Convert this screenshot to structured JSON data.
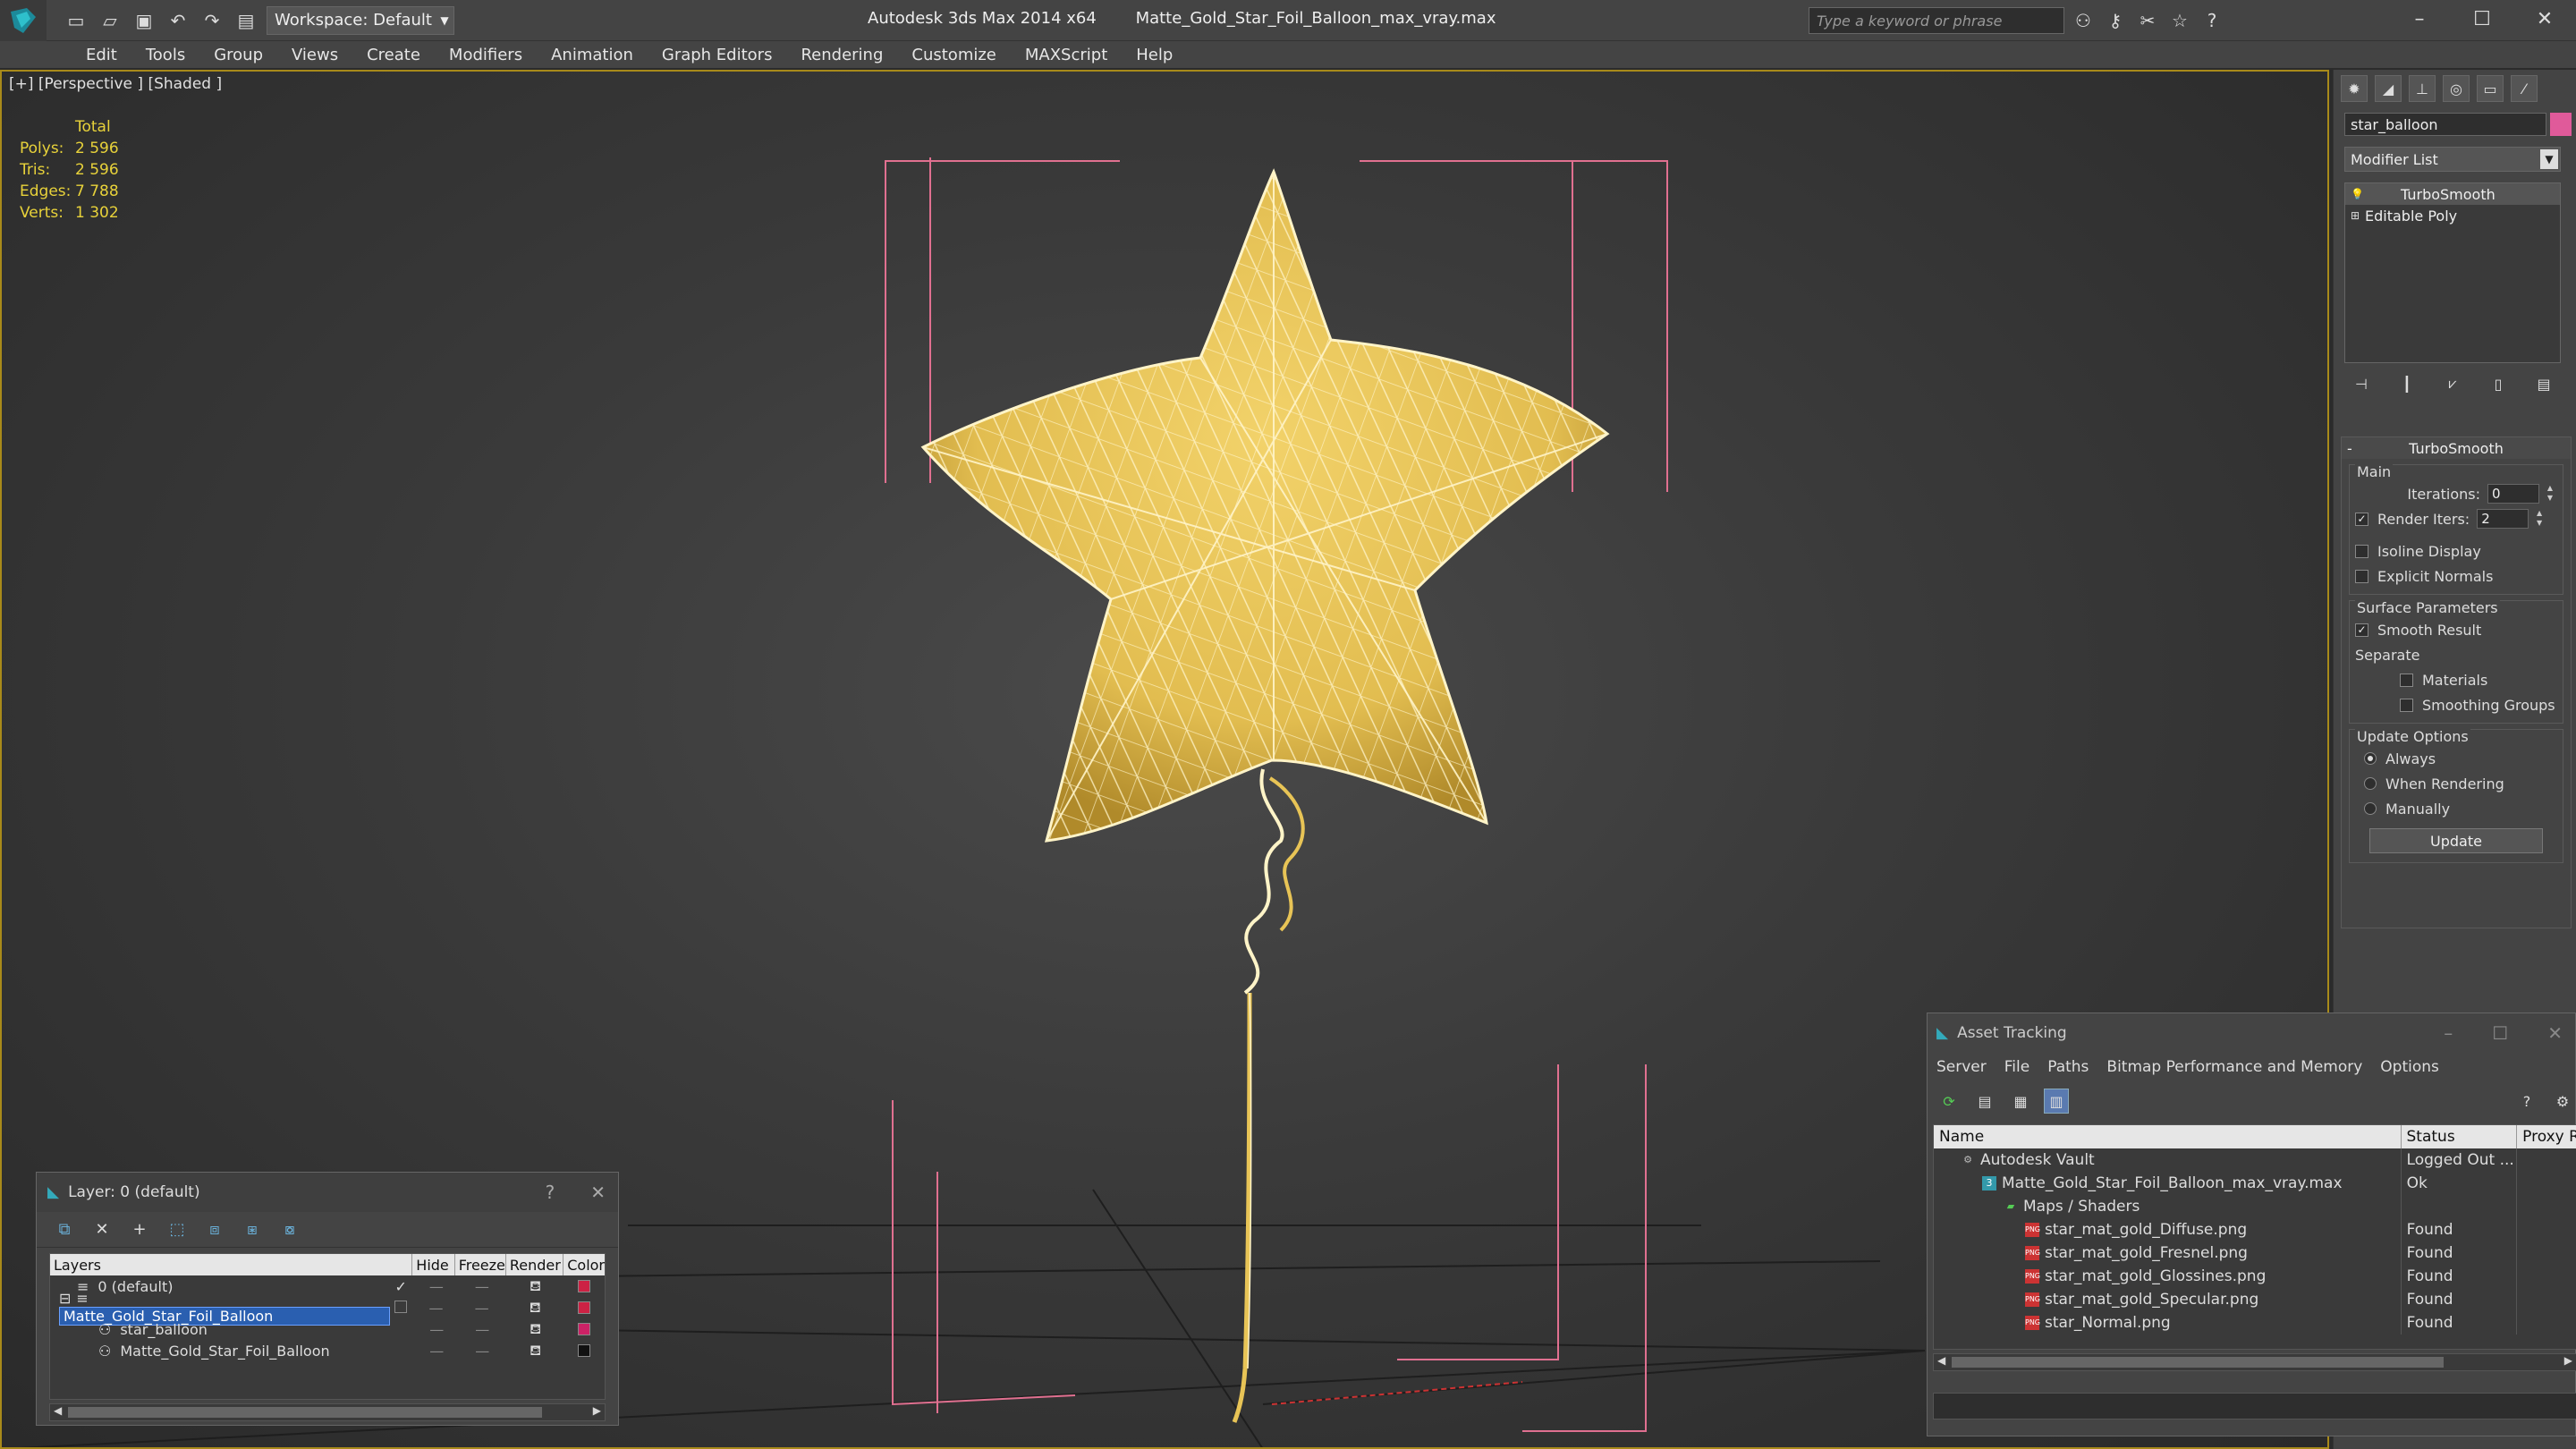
{
  "titlebar": {
    "workspace": "Workspace: Default",
    "app_title": "Autodesk 3ds Max  2014 x64",
    "file_title": "Matte_Gold_Star_Foil_Balloon_max_vray.max",
    "search_placeholder": "Type a keyword or phrase"
  },
  "menu": [
    "Edit",
    "Tools",
    "Group",
    "Views",
    "Create",
    "Modifiers",
    "Animation",
    "Graph Editors",
    "Rendering",
    "Customize",
    "MAXScript",
    "Help"
  ],
  "viewport": {
    "label": "[+] [Perspective ] [Shaded ]",
    "stats": {
      "header": "Total",
      "rows": [
        {
          "k": "Polys:",
          "v": "2 596"
        },
        {
          "k": "Tris:",
          "v": "2 596"
        },
        {
          "k": "Edges:",
          "v": "7 788"
        },
        {
          "k": "Verts:",
          "v": "1 302"
        }
      ]
    }
  },
  "command_panel": {
    "object_name": "star_balloon",
    "object_color": "#e05a9a",
    "modifier_list": "Modifier List",
    "stack": [
      "TurboSmooth",
      "Editable Poly"
    ],
    "rollout_title": "TurboSmooth",
    "main_group": "Main",
    "iterations_label": "Iterations:",
    "iterations_value": "0",
    "render_iters_label": "Render Iters:",
    "render_iters_value": "2",
    "isoline": "Isoline Display",
    "explicit_normals": "Explicit Normals",
    "surface_group": "Surface Parameters",
    "smooth_result": "Smooth Result",
    "separate": "Separate",
    "materials": "Materials",
    "smoothing_groups": "Smoothing Groups",
    "update_group": "Update Options",
    "always": "Always",
    "when_rendering": "When Rendering",
    "manually": "Manually",
    "update_btn": "Update"
  },
  "layer_window": {
    "title": "Layer: 0 (default)",
    "help": "?",
    "columns": [
      "Layers",
      "Hide",
      "Freeze",
      "Render",
      "Color"
    ],
    "rows": [
      {
        "name": "0 (default)",
        "check": "✓",
        "color": "#cc2244"
      },
      {
        "name": "Matte_Gold_Star_Foil_Balloon",
        "check": "",
        "color": "#cc2244"
      },
      {
        "name": "star_balloon",
        "check": "",
        "color": "#cc2266"
      },
      {
        "name": "Matte_Gold_Star_Foil_Balloon",
        "check": "",
        "color": "#111111"
      }
    ]
  },
  "asset_tracking": {
    "title": "Asset Tracking",
    "menu": [
      "Server",
      "File",
      "Paths",
      "Bitmap Performance and Memory",
      "Options"
    ],
    "columns": [
      "Name",
      "Status",
      "Proxy R"
    ],
    "rows": [
      {
        "name": "Autodesk Vault",
        "status": "Logged Out ...",
        "icon": "vault"
      },
      {
        "name": "Matte_Gold_Star_Foil_Balloon_max_vray.max",
        "status": "Ok",
        "icon": "max"
      },
      {
        "name": "Maps / Shaders",
        "status": "",
        "icon": "map"
      },
      {
        "name": "star_mat_gold_Diffuse.png",
        "status": "Found",
        "icon": "png"
      },
      {
        "name": "star_mat_gold_Fresnel.png",
        "status": "Found",
        "icon": "png"
      },
      {
        "name": "star_mat_gold_Glossines.png",
        "status": "Found",
        "icon": "png"
      },
      {
        "name": "star_mat_gold_Specular.png",
        "status": "Found",
        "icon": "png"
      },
      {
        "name": "star_Normal.png",
        "status": "Found",
        "icon": "png"
      }
    ]
  },
  "colors": {
    "balloon": "#e8c456",
    "accent": "#a88a1a",
    "bracket": "#e07090"
  }
}
